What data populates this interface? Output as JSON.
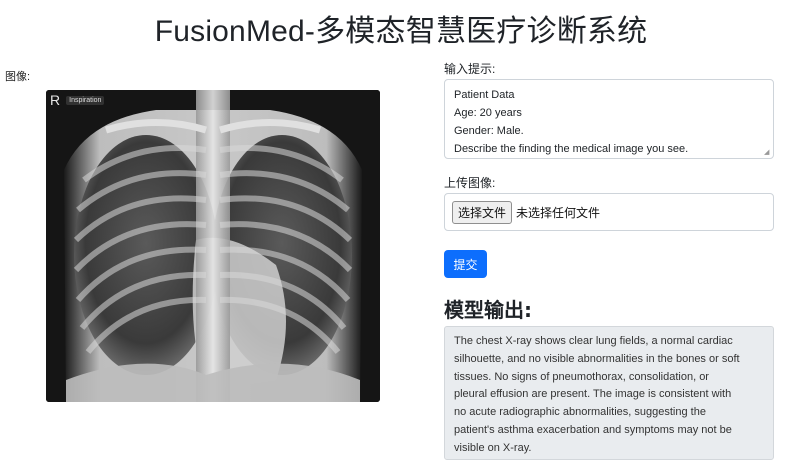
{
  "app": {
    "title": "FusionMed-多模态智慧医疗诊断系统"
  },
  "left": {
    "image_label": "图像:",
    "watermark": {
      "letter": "R",
      "tag": "Inspiration"
    }
  },
  "form": {
    "prompt_label": "输入提示:",
    "prompt_lines": [
      "Patient Data",
      "Age: 20 years",
      "Gender: Male.",
      "Describe the finding the medical image you see."
    ],
    "upload_label": "上传图像:",
    "choose_file_button": "选择文件",
    "no_file_text": "未选择任何文件",
    "submit_button": "提交"
  },
  "output": {
    "heading": "模型输出:",
    "lines": [
      "The chest X-ray shows clear lung fields, a normal cardiac",
      "silhouette, and no visible abnormalities in the bones or soft",
      "tissues. No signs of pneumothorax, consolidation, or",
      "pleural effusion are present. The image is consistent with",
      "no acute radiographic abnormalities, suggesting the",
      "patient's asthma exacerbation and symptoms may not be",
      "visible on X-ray."
    ]
  },
  "colors": {
    "primary_button": "#0d6efd",
    "output_background": "#e9ecef",
    "border": "#ced4da"
  }
}
